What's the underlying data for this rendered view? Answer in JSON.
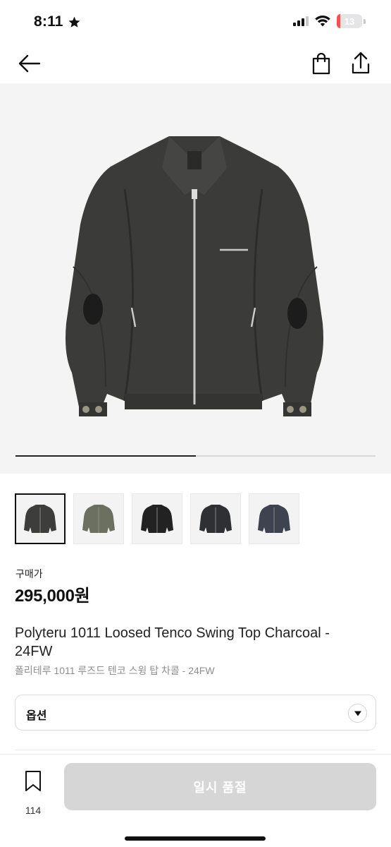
{
  "status": {
    "time": "8:11",
    "star_icon": "star-icon",
    "battery_level": "13",
    "battery_color": "#f0524f"
  },
  "nav": {
    "back_icon": "arrow-left-icon",
    "cart_icon": "shopping-bag-icon",
    "share_icon": "share-icon"
  },
  "gallery": {
    "image_subject": "charcoal zip-up swing top jacket",
    "carousel_progress": 0.5,
    "thumbnails": [
      {
        "name": "charcoal",
        "color": "#3d3d3b",
        "selected": true
      },
      {
        "name": "khaki",
        "color": "#6b7060",
        "selected": false
      },
      {
        "name": "black",
        "color": "#222222",
        "selected": false
      },
      {
        "name": "black-collar",
        "color": "#2f3033",
        "selected": false
      },
      {
        "name": "navy",
        "color": "#3f4350",
        "selected": false
      }
    ]
  },
  "price": {
    "label": "구매가",
    "value": "295,000원"
  },
  "product": {
    "title_en": "Polyteru 1011 Loosed Tenco Swing Top Charcoal - 24FW",
    "title_ko": "폴리테루 1011 루즈드 텐코 스윙 탑 차콜 - 24FW"
  },
  "option": {
    "label": "옵션",
    "arrow_icon": "caret-down-icon"
  },
  "bottom": {
    "bookmark_icon": "bookmark-icon",
    "bookmark_count": "114",
    "soldout_label": "일시 품절"
  }
}
